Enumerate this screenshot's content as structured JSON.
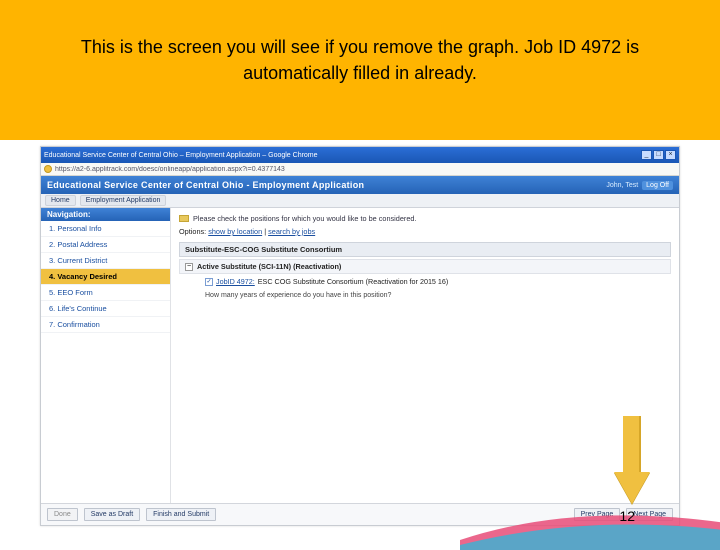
{
  "slide": {
    "caption": "This is the screen you will see if you remove the graph. Job ID 4972 is automatically filled in already.",
    "page_number": "12"
  },
  "window": {
    "title": "Educational Service Center of Central Ohio – Employment Application – Google Chrome",
    "url": "https://a2-6.applitrack.com/doesc/onlineapp/application.aspx?i=0.4377143"
  },
  "app": {
    "title": "Educational Service Center of Central Ohio - Employment Application",
    "username": "John, Test",
    "logoff": "Log Off"
  },
  "crumbs": {
    "home": "Home",
    "current": "Employment Application"
  },
  "nav": {
    "header": "Navigation:",
    "items": [
      "1. Personal Info",
      "2. Postal Address",
      "3. Current District",
      "4. Vacancy Desired",
      "5. EEO Form",
      "6. Life's Continue",
      "7. Confirmation"
    ],
    "selected_index": 3
  },
  "content": {
    "notice": "Please check the positions for which you would like to be considered.",
    "options_label": "Options:",
    "options_link1": "show by location",
    "options_sep": " | ",
    "options_link2": "search by jobs",
    "group_title": "Substitute-ESC-COG Substitute Consortium",
    "subgroup_title": "Active Substitute (SCI-11N) (Reactivation)",
    "job_check": "✓",
    "job_link": "JobID 4972:",
    "job_rest": " ESC COG Substitute Consortium (Reactivation for 2015 16)",
    "question": "How many years of experience do you have in this position?"
  },
  "footer": {
    "save_draft": "Save as Draft",
    "finish": "Finish and Submit",
    "prev": "Prev Page",
    "next": "Next Page",
    "status": "Done"
  }
}
